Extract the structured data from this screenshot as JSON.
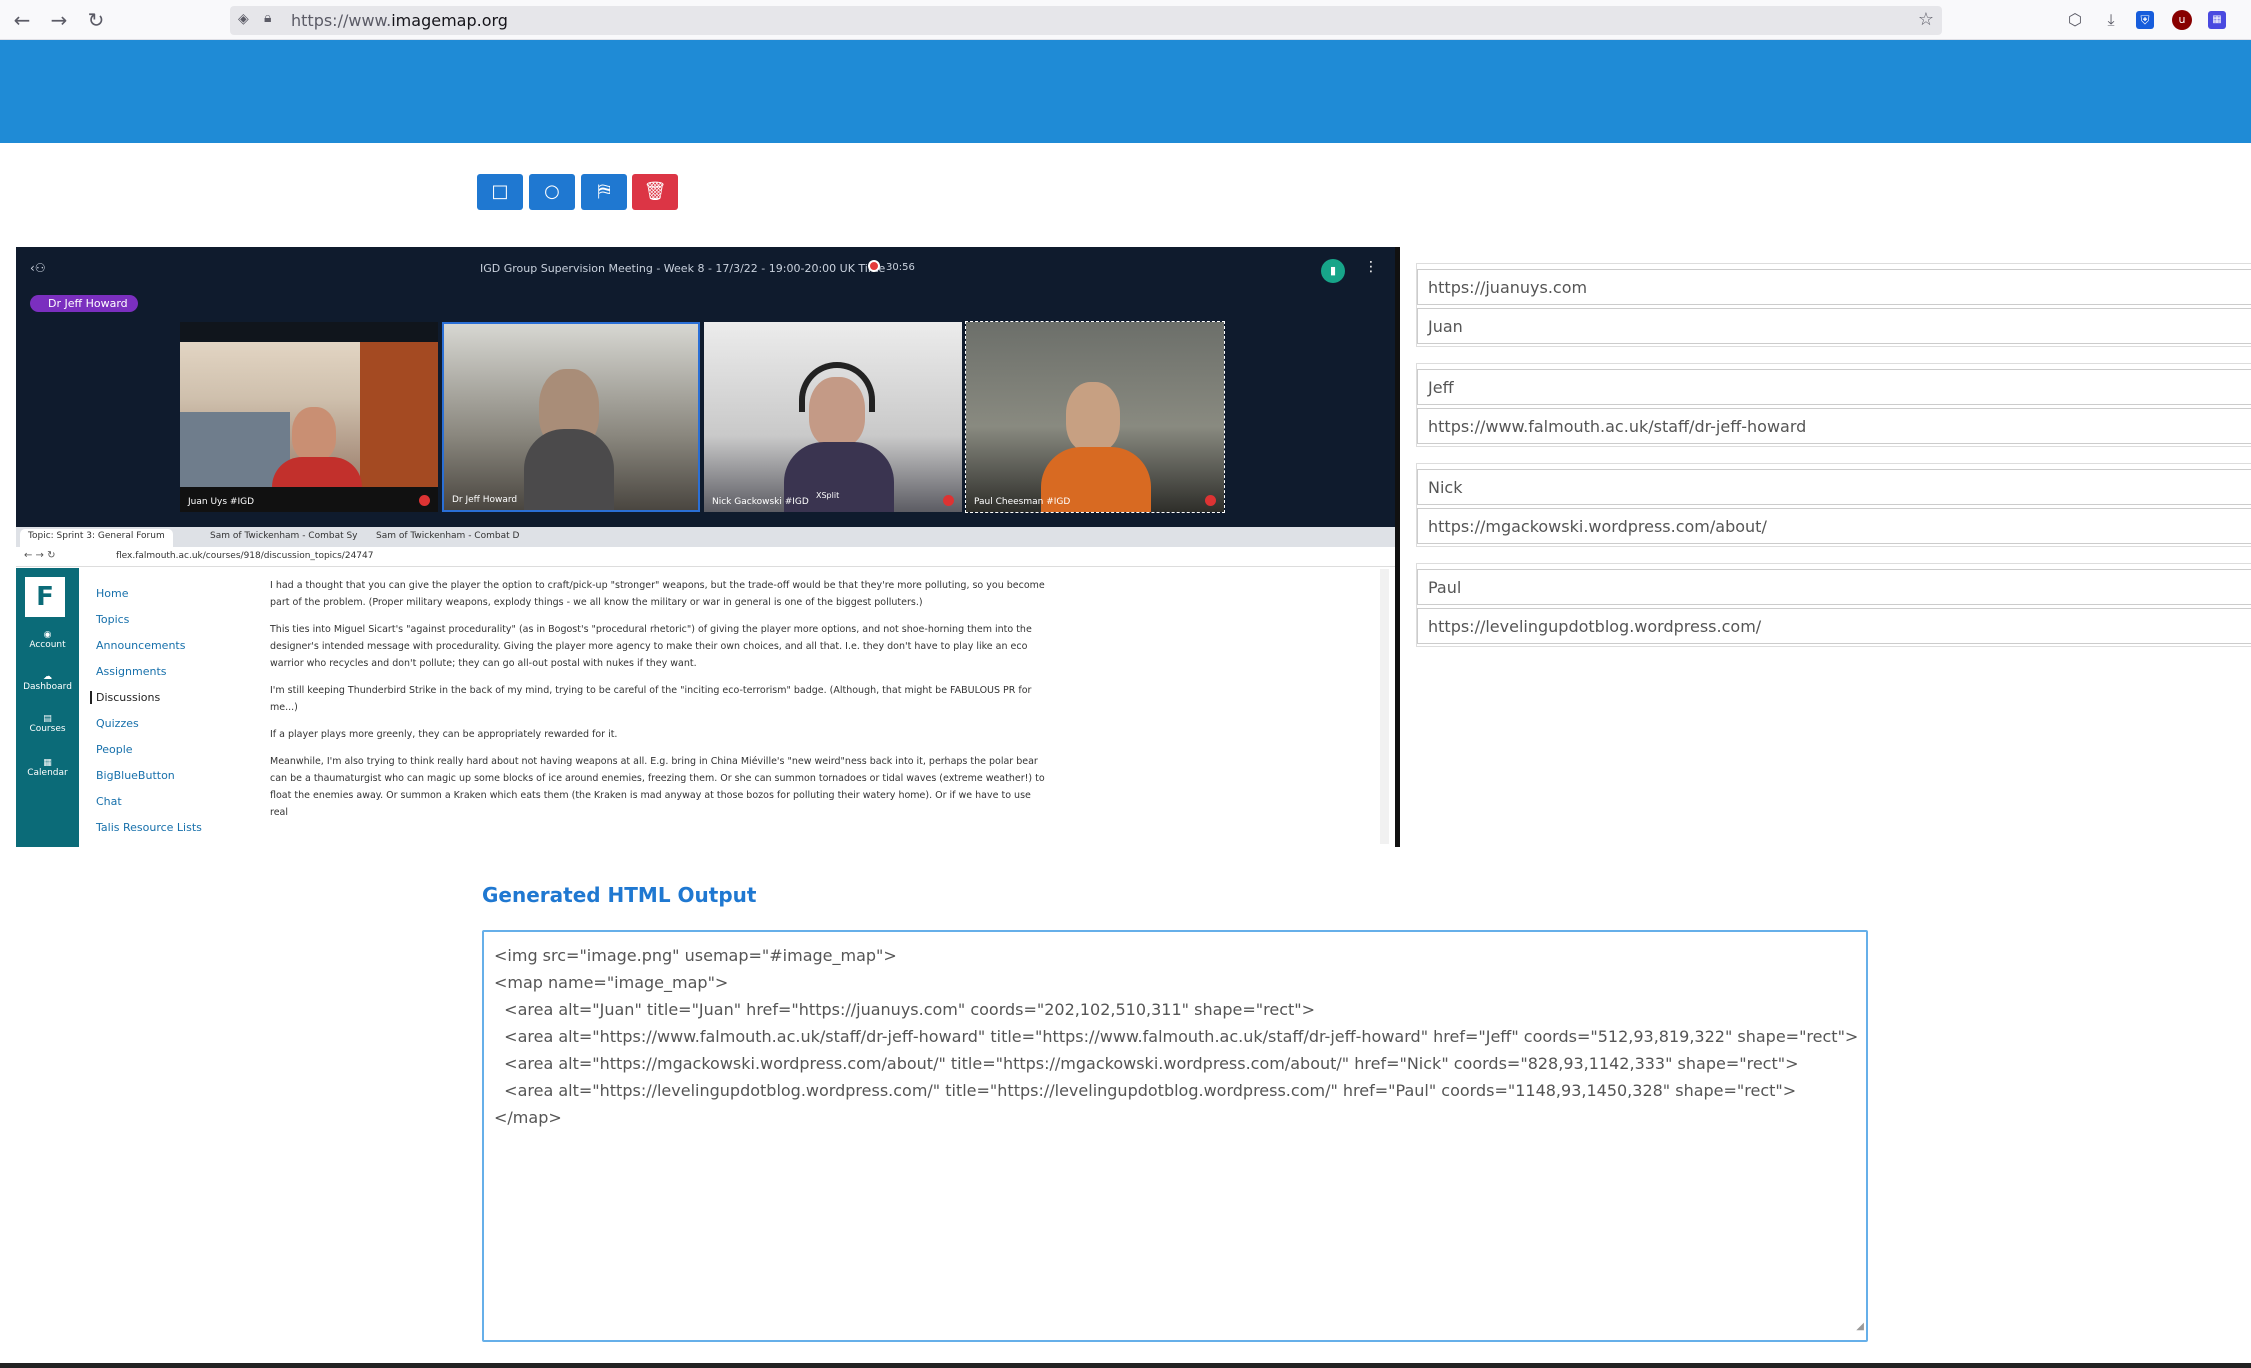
{
  "browser": {
    "url_prefix": "https://www.",
    "url_domain": "imagemap.org",
    "nav": [
      "back-arrow",
      "forward-arrow",
      "reload-icon"
    ]
  },
  "toolbar": {
    "rect_tool": "rectangle-icon",
    "circle_tool": "circle-icon",
    "poly_tool": "polygon-icon",
    "delete_tool": "trash-icon",
    "colors": {
      "primary": "#1f78d1",
      "danger": "#dc3545",
      "banner": "#1f8bd6"
    }
  },
  "image": {
    "meeting_title": "IGD Group Supervision Meeting - Week 8 - 17/3/22 - 19:00-20:00 UK Time",
    "recording_time": "30:56",
    "speaker_chip": "Dr Jeff Howard",
    "participants": [
      "Juan Uys #IGD",
      "Dr Jeff Howard",
      "Nick Gackowski #IGD",
      "Paul Cheesman #IGD"
    ],
    "xsplit_label": "XSplit",
    "tabs": [
      "Topic: Sprint 3: General Forum",
      "Sam of Twickenham - Combat Sy",
      "Sam of Twickenham - Combat D"
    ],
    "lms_url": "flex.falmouth.ac.uk/courses/918/discussion_topics/24747",
    "lms_logo": "F",
    "lms_side": [
      "Account",
      "Dashboard",
      "Courses",
      "Calendar"
    ],
    "lms_nav": [
      "Home",
      "Topics",
      "Announcements",
      "Assignments",
      "Discussions",
      "Quizzes",
      "People",
      "BigBlueButton",
      "Chat",
      "Talis Resource Lists"
    ],
    "post_paragraphs": [
      "I had a thought that you can give the player the option to craft/pick-up \"stronger\" weapons, but the trade-off would be that they're more polluting, so you become part of the problem. (Proper military weapons, explody things - we all know the military or war in general is one of the biggest polluters.)",
      "This ties into Miguel Sicart's \"against procedurality\" (as in Bogost's \"procedural rhetoric\") of giving the player more options, and not shoe-horning them into the designer's intended message with procedurality. Giving the player more agency to make their own choices, and all that. I.e. they don't have to play like an eco warrior who recycles and don't pollute; they can go all-out postal with nukes if they want.",
      "I'm still keeping Thunderbird Strike in the back of my mind, trying to be careful of the \"inciting eco-terrorism\" badge. (Although, that might be FABULOUS PR for me...)",
      "If a player plays more greenly, they can be appropriately rewarded for it.",
      "Meanwhile, I'm also trying to think really hard about not having weapons at all. E.g. bring in China Miéville's \"new weird\"ness back into it, perhaps the polar bear can be a thaumaturgist who can magic up some blocks of ice around enemies, freezing them. Or she can summon tornadoes or tidal waves (extreme weather!) to float the enemies away. Or summon a Kraken which eats them (the Kraken is mad anyway at those bozos for polluting their watery home). Or if we have to use real"
    ]
  },
  "areas": [
    {
      "field1": "https://juanuys.com",
      "field2": "Juan"
    },
    {
      "field1": "Jeff",
      "field2": "https://www.falmouth.ac.uk/staff/dr-jeff-howard"
    },
    {
      "field1": "Nick",
      "field2": "https://mgackowski.wordpress.com/about/"
    },
    {
      "field1": "Paul",
      "field2": "https://levelingupdotblog.wordpress.com/"
    }
  ],
  "output": {
    "title": "Generated HTML Output",
    "lines": [
      "<img src=\"image.png\" usemap=\"#image_map\">",
      "<map name=\"image_map\">",
      "  <area alt=\"Juan\" title=\"Juan\" href=\"https://juanuys.com\" coords=\"202,102,510,311\" shape=\"rect\">",
      "  <area alt=\"https://www.falmouth.ac.uk/staff/dr-jeff-howard\" title=\"https://www.falmouth.ac.uk/staff/dr-jeff-howard\" href=\"Jeff\" coords=\"512,93,819,322\" shape=\"rect\">",
      "  <area alt=\"https://mgackowski.wordpress.com/about/\" title=\"https://mgackowski.wordpress.com/about/\" href=\"Nick\" coords=\"828,93,1142,333\" shape=\"rect\">",
      "  <area alt=\"https://levelingupdotblog.wordpress.com/\" title=\"https://levelingupdotblog.wordpress.com/\" href=\"Paul\" coords=\"1148,93,1450,328\" shape=\"rect\">",
      "</map>"
    ]
  }
}
